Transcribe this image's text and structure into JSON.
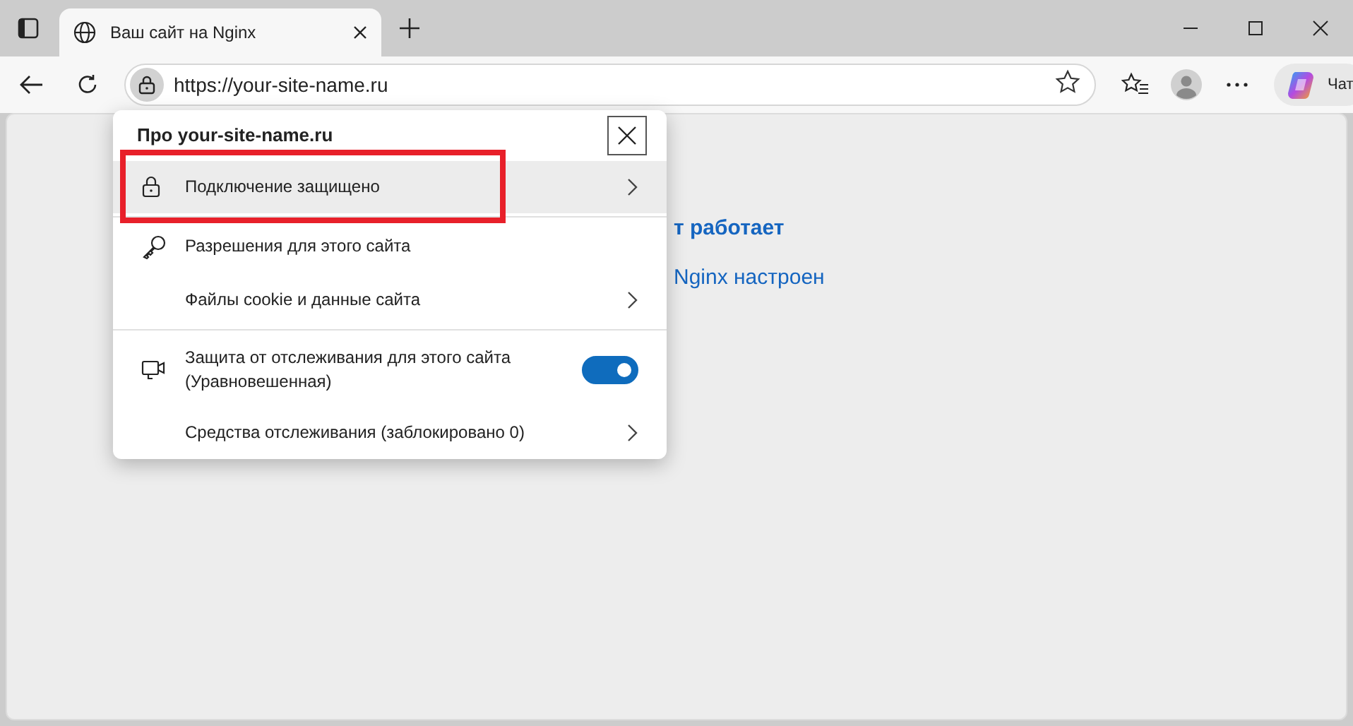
{
  "tab": {
    "title": "Ваш сайт на Nginx",
    "selected": true
  },
  "address_bar": {
    "url": "https://your-site-name.ru"
  },
  "chat_button": {
    "label": "Чат"
  },
  "page": {
    "lines": [
      {
        "kind": "heading",
        "text": "т работает"
      },
      {
        "kind": "text",
        "text": "Nginx настроен"
      }
    ]
  },
  "site_info_popup": {
    "title": "Про your-site-name.ru",
    "items": [
      {
        "kind": "secure",
        "label": "Подключение защищено",
        "selected": true,
        "highlighted": true
      },
      {
        "kind": "permissions",
        "label": "Разрешения для этого сайта",
        "selected": false,
        "highlighted": false
      },
      {
        "kind": "link",
        "label": "Файлы cookie и данные сайта",
        "selected": false,
        "highlighted": false
      },
      {
        "kind": "toggle",
        "label": "Защита от отслеживания для этого сайта (Уравновешенная)",
        "on": true,
        "selected": false,
        "highlighted": false
      },
      {
        "kind": "link",
        "label": "Средства отслеживания (заблокировано 0)",
        "selected": false,
        "highlighted": false
      }
    ]
  }
}
